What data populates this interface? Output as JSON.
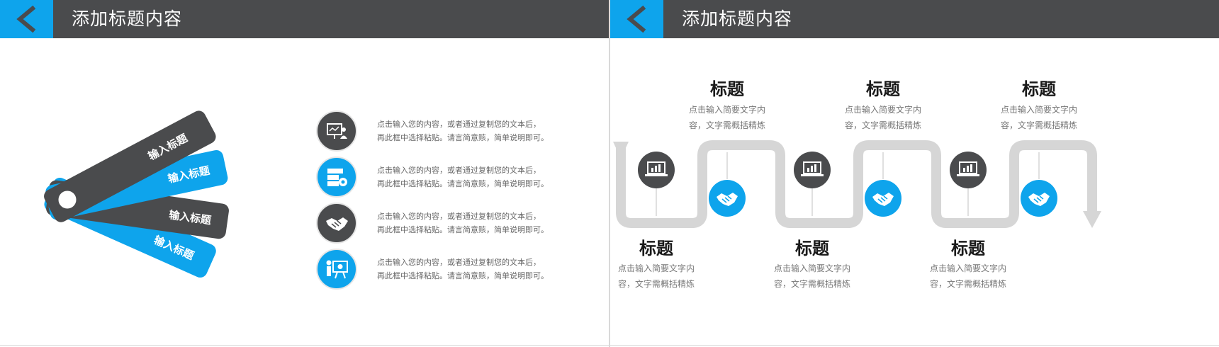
{
  "left_slide": {
    "header_title": "添加标题内容",
    "cards": [
      {
        "label": "输入标题"
      },
      {
        "label": "输入标题"
      },
      {
        "label": "输入标题"
      },
      {
        "label": "输入标题"
      }
    ],
    "items": [
      {
        "icon": "presentation-user-icon",
        "line1": "点击输入您的内容，或者通过复制您的文本后，",
        "line2": "再此框中选择粘贴。请言简意赅，简单说明即可。"
      },
      {
        "icon": "server-gear-icon",
        "line1": "点击输入您的内容，或者通过复制您的文本后，",
        "line2": "再此框中选择粘贴。请言简意赅，简单说明即可。"
      },
      {
        "icon": "handshake-icon",
        "line1": "点击输入您的内容，或者通过复制您的文本后，",
        "line2": "再此框中选择粘贴。请言简意赅，简单说明即可。"
      },
      {
        "icon": "presenter-board-icon",
        "line1": "点击输入您的内容，或者通过复制您的文本后，",
        "line2": "再此框中选择粘贴。请言简意赅，简单说明即可。"
      }
    ]
  },
  "right_slide": {
    "header_title": "添加标题内容",
    "steps": [
      {
        "title": "标题",
        "desc1": "点击输入简要文字内",
        "desc2": "容，文字需概括精炼",
        "icon": "laptop-chart-icon"
      },
      {
        "title": "标题",
        "desc1": "点击输入简要文字内",
        "desc2": "容，文字需概括精炼",
        "icon": "handshake-icon"
      },
      {
        "title": "标题",
        "desc1": "点击输入简要文字内",
        "desc2": "容，文字需概括精炼",
        "icon": "laptop-chart-icon"
      },
      {
        "title": "标题",
        "desc1": "点击输入简要文字内",
        "desc2": "容，文字需概括精炼",
        "icon": "handshake-icon"
      },
      {
        "title": "标题",
        "desc1": "点击输入简要文字内",
        "desc2": "容，文字需概括精炼",
        "icon": "laptop-chart-icon"
      },
      {
        "title": "标题",
        "desc1": "点击输入简要文字内",
        "desc2": "容，文字需概括精炼",
        "icon": "handshake-icon"
      }
    ]
  },
  "colors": {
    "blue": "#0ea4ec",
    "dark": "#4a4b4d",
    "track": "#d6d6d6"
  }
}
